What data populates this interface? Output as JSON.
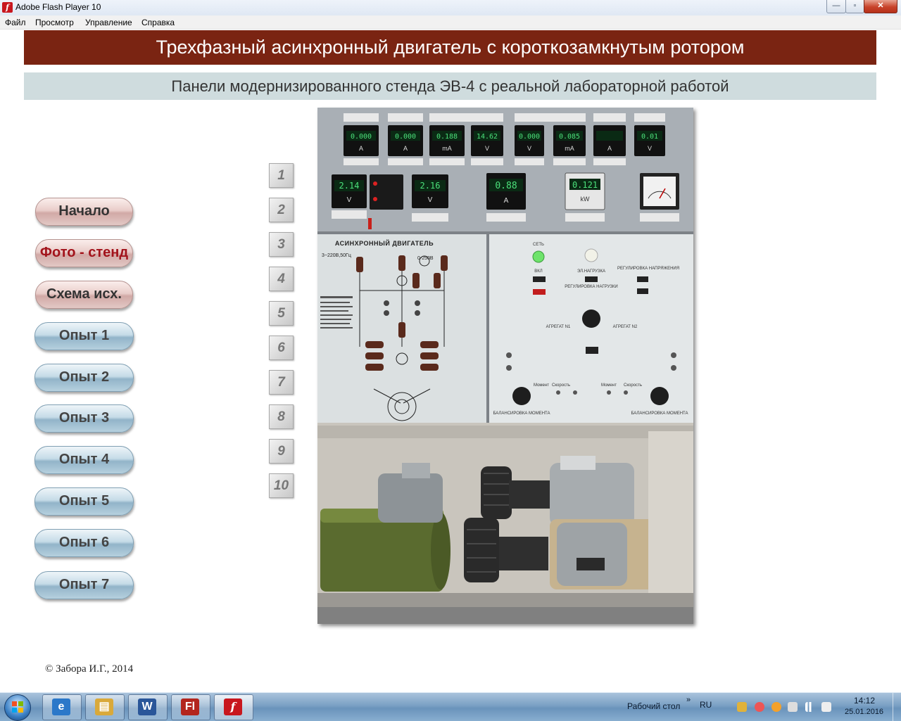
{
  "window": {
    "title": "Adobe Flash Player 10",
    "app_icon_glyph": "f",
    "controls": {
      "minimize": "—",
      "maximize": "▫",
      "close": "✕"
    }
  },
  "menu": [
    "Файл",
    "Просмотр",
    "Управление",
    "Справка"
  ],
  "header": {
    "title": "Трехфазный асинхронный двигатель с короткозамкнутым ротором",
    "subtitle": "Панели модернизированного стенда ЭВ-4 с реальной лабораторной работой"
  },
  "nav": [
    {
      "label": "Начало",
      "style": "pink",
      "active": false
    },
    {
      "label": "Фото - стенд",
      "style": "pink",
      "active": true
    },
    {
      "label": "Схема исх.",
      "style": "pink",
      "active": false
    },
    {
      "label": "Опыт 1",
      "style": "blue",
      "active": false
    },
    {
      "label": "Опыт 2",
      "style": "blue",
      "active": false
    },
    {
      "label": "Опыт 3",
      "style": "blue",
      "active": false
    },
    {
      "label": "Опыт 4",
      "style": "blue",
      "active": false
    },
    {
      "label": "Опыт 5",
      "style": "blue",
      "active": false
    },
    {
      "label": "Опыт 6",
      "style": "blue",
      "active": false
    },
    {
      "label": "Опыт 7",
      "style": "blue",
      "active": false
    }
  ],
  "number_tabs": [
    "1",
    "2",
    "3",
    "4",
    "5",
    "6",
    "7",
    "8",
    "9",
    "10"
  ],
  "stand_photo": {
    "meter_row1": [
      {
        "reading": "0.000",
        "unit": "A"
      },
      {
        "reading": "0.000",
        "unit": "A"
      },
      {
        "reading": "0.188",
        "unit": "mA"
      },
      {
        "reading": "14.62",
        "unit": "V"
      },
      {
        "reading": "0.000",
        "unit": "V"
      },
      {
        "reading": "0.085",
        "unit": "mA"
      },
      {
        "reading": "",
        "unit": "A"
      },
      {
        "reading": "0.01",
        "unit": "V"
      }
    ],
    "meter_row2": [
      {
        "reading": "2.14",
        "unit": "V"
      },
      {
        "reading": "2.16",
        "unit": "V"
      },
      {
        "reading": "0.88",
        "unit": "A"
      },
      {
        "reading": "0.121",
        "unit": "kW"
      }
    ],
    "diagram_title": "АСИНХРОННЫЙ ДВИГАТЕЛЬ",
    "supply_label": "3~220В,50Гц",
    "voltmeter_range": "0-250В",
    "panel_labels": {
      "network": "СЕТЬ",
      "on": "ВКЛ",
      "load": "ЭЛ.НАГРУЗКА",
      "load_regulation": "РЕГУЛИРОВКА НАГРУЗКИ",
      "voltage_regulation": "РЕГУЛИРОВКА НАПРЯЖЕНИЯ",
      "unit1": "АГРЕГАТ N1",
      "unit2": "АГРЕГАТ N2",
      "torque_balance": "БАЛАНСИРОВКА МОМЕНТА",
      "moment": "Момент",
      "speed": "Скорость"
    }
  },
  "copyright": "© Забора И.Г., 2014",
  "taskbar": {
    "desktop_label": "Рабочий стол",
    "language": "RU",
    "time": "14:12",
    "date": "25.01.2016",
    "chevron": "»",
    "apps": [
      {
        "name": "ie-icon",
        "glyph": "e",
        "color": "#2b78c9"
      },
      {
        "name": "explorer-icon",
        "glyph": "▤",
        "color": "#d9a93a"
      },
      {
        "name": "word-icon",
        "glyph": "W",
        "color": "#2a5699"
      },
      {
        "name": "flash-pro-icon",
        "glyph": "Fl",
        "color": "#b3261e"
      },
      {
        "name": "flash-player-icon",
        "glyph": "f",
        "color": "#c8171e"
      }
    ]
  }
}
